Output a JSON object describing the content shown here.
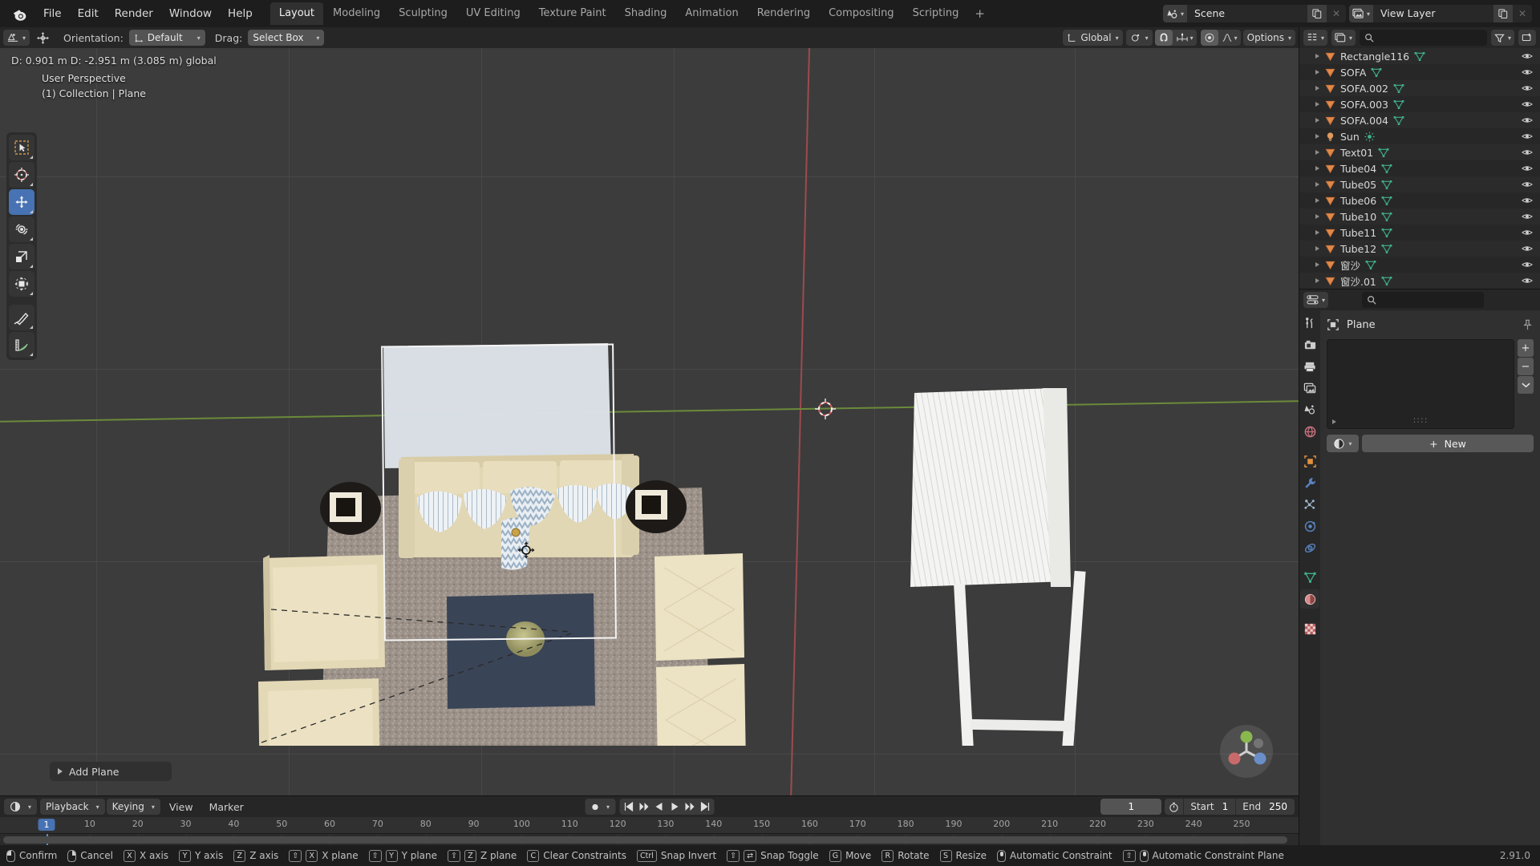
{
  "app": {
    "name": "Blender",
    "version": "2.91.0"
  },
  "topbar": {
    "logo_icon": "blender-logo-icon",
    "menus": [
      "File",
      "Edit",
      "Render",
      "Window",
      "Help"
    ],
    "workspaces": [
      {
        "label": "Layout",
        "active": true
      },
      {
        "label": "Modeling",
        "active": false
      },
      {
        "label": "Sculpting",
        "active": false
      },
      {
        "label": "UV Editing",
        "active": false
      },
      {
        "label": "Texture Paint",
        "active": false
      },
      {
        "label": "Shading",
        "active": false
      },
      {
        "label": "Animation",
        "active": false
      },
      {
        "label": "Rendering",
        "active": false
      },
      {
        "label": "Compositing",
        "active": false
      },
      {
        "label": "Scripting",
        "active": false
      }
    ],
    "add_workspace_label": "+",
    "scene": {
      "icon": "scene-icon",
      "value": "Scene",
      "new_icon": "duplicate-icon",
      "remove_icon": "x-icon"
    },
    "view_layer": {
      "icon": "view-layer-icon",
      "value": "View Layer",
      "new_icon": "duplicate-icon",
      "remove_icon": "x-icon"
    }
  },
  "viewport_header": {
    "editor_type_icon": "editor-type-icon",
    "mode_icon": "object-mode-icon",
    "transform_icon": "transform-gizmo-icon",
    "orientation_label": "Orientation:",
    "orientation_value": "Default",
    "drag_label": "Drag:",
    "drag_value": "Select Box",
    "pivot_icon": "transform-pivot-icon",
    "global_label": "Global",
    "snap_magnet_icon": "snap-magnet-icon",
    "snap_target_icon": "snap-increment-icon",
    "proportional_icon": "proportional-edit-icon",
    "falloff_icon": "falloff-curve-icon",
    "options_label": "Options"
  },
  "viewport": {
    "transform_readout": "D: 0.901 m   D: -2.951 m (3.085 m) global",
    "perspective": "User Perspective",
    "collection_line": "(1) Collection | Plane",
    "operator_panel": "Add Plane",
    "navigation_gizmo_icon": "navigation-gizmo-icon",
    "cursor_3d_icon": "3d-cursor-icon",
    "move_gizmo_icon": "move-gizmo-icon",
    "tools": [
      {
        "name": "tweak-tool",
        "icon": "cursor-arrow-icon",
        "active": false
      },
      {
        "name": "cursor-tool",
        "icon": "3d-cursor-icon",
        "active": false
      },
      {
        "name": "move-tool",
        "icon": "move-arrows-icon",
        "active": true
      },
      {
        "name": "rotate-tool",
        "icon": "rotate-icon",
        "active": false
      },
      {
        "name": "scale-tool",
        "icon": "scale-icon",
        "active": false
      },
      {
        "name": "transform-tool",
        "icon": "transform-icon",
        "active": false
      },
      {
        "name": "annotate-tool",
        "icon": "pencil-icon",
        "active": false
      },
      {
        "name": "measure-tool",
        "icon": "ruler-icon",
        "active": false
      }
    ],
    "scene_objects": {
      "floor_rug_color": "#9b9087",
      "sofa_color": "#e4d9b6",
      "coffee_table_color": "#3a4456",
      "wall_color": "#dde3e8",
      "side_table_color": "#211c19",
      "shelf_color": "#f2f2f0",
      "plant_color": "#a8a271"
    }
  },
  "outliner": {
    "editor_icon": "outliner-icon",
    "display_mode_icon": "view-layer-icon",
    "search_placeholder": "",
    "search_icon": "search-icon",
    "filter_icon": "filter-funnel-icon",
    "new_collection_icon": "new-collection-icon",
    "items": [
      {
        "name": "Rectangle116",
        "type_icon": "mesh-object-icon",
        "data_icon": "mesh-data-icon"
      },
      {
        "name": "SOFA",
        "type_icon": "mesh-object-icon",
        "data_icon": "mesh-data-icon"
      },
      {
        "name": "SOFA.002",
        "type_icon": "mesh-object-icon",
        "data_icon": "mesh-data-icon"
      },
      {
        "name": "SOFA.003",
        "type_icon": "mesh-object-icon",
        "data_icon": "mesh-data-icon"
      },
      {
        "name": "SOFA.004",
        "type_icon": "mesh-object-icon",
        "data_icon": "mesh-data-icon"
      },
      {
        "name": "Sun",
        "type_icon": "light-object-icon",
        "data_icon": "sun-data-icon"
      },
      {
        "name": "Text01",
        "type_icon": "mesh-object-icon",
        "data_icon": "mesh-data-icon"
      },
      {
        "name": "Tube04",
        "type_icon": "mesh-object-icon",
        "data_icon": "mesh-data-icon"
      },
      {
        "name": "Tube05",
        "type_icon": "mesh-object-icon",
        "data_icon": "mesh-data-icon"
      },
      {
        "name": "Tube06",
        "type_icon": "mesh-object-icon",
        "data_icon": "mesh-data-icon"
      },
      {
        "name": "Tube10",
        "type_icon": "mesh-object-icon",
        "data_icon": "mesh-data-icon"
      },
      {
        "name": "Tube11",
        "type_icon": "mesh-object-icon",
        "data_icon": "mesh-data-icon"
      },
      {
        "name": "Tube12",
        "type_icon": "mesh-object-icon",
        "data_icon": "mesh-data-icon"
      },
      {
        "name": "窗沙",
        "type_icon": "mesh-object-icon",
        "data_icon": "mesh-data-icon"
      },
      {
        "name": "窗沙.01",
        "type_icon": "mesh-object-icon",
        "data_icon": "mesh-data-icon"
      }
    ],
    "visibility_icon": "eye-icon"
  },
  "properties": {
    "editor_icon": "properties-icon",
    "search_placeholder": "",
    "search_icon": "search-icon",
    "object_name": "Plane",
    "object_icon": "object-data-icon",
    "pin_icon": "pin-icon",
    "slot_add_label": "+",
    "slot_remove_label": "−",
    "slot_menu_icon": "chevron-down-icon",
    "slot_dots": "::::",
    "browse_material_icon": "material-sphere-icon",
    "new_label": "New",
    "new_plus": "+",
    "tabs": [
      {
        "name": "tool",
        "icon": "tool-wrench-screwdriver-icon",
        "active": false
      },
      {
        "name": "render",
        "icon": "camera-back-icon",
        "active": false
      },
      {
        "name": "output",
        "icon": "printer-icon",
        "active": false
      },
      {
        "name": "view-layer",
        "icon": "images-icon",
        "active": false
      },
      {
        "name": "scene",
        "icon": "scene-cone-icon",
        "active": false
      },
      {
        "name": "world",
        "icon": "world-globe-icon",
        "active": false
      },
      {
        "name": "object",
        "icon": "object-square-icon",
        "active": false
      },
      {
        "name": "modifiers",
        "icon": "wrench-icon",
        "active": false
      },
      {
        "name": "particles",
        "icon": "particles-icon",
        "active": false
      },
      {
        "name": "physics",
        "icon": "physics-orbit-icon",
        "active": false
      },
      {
        "name": "constraints",
        "icon": "constraint-icon",
        "active": false
      },
      {
        "name": "object-data",
        "icon": "mesh-data-icon",
        "active": false
      },
      {
        "name": "material",
        "icon": "material-sphere-icon",
        "active": true
      },
      {
        "name": "texture",
        "icon": "texture-checker-icon",
        "active": false
      }
    ]
  },
  "timeline": {
    "editor_icon": "timeline-icon",
    "menus": [
      {
        "label": "Playback",
        "dropdown": true
      },
      {
        "label": "Keying",
        "dropdown": true
      },
      {
        "label": "View",
        "dropdown": false
      },
      {
        "label": "Marker",
        "dropdown": false
      }
    ],
    "auto_key_icon": "record-dot-icon",
    "transport": [
      {
        "name": "jump-to-start-button",
        "icon": "skip-start-icon"
      },
      {
        "name": "jump-to-prev-keyframe-button",
        "icon": "prev-keyframe-icon"
      },
      {
        "name": "play-reverse-button",
        "icon": "play-reverse-icon"
      },
      {
        "name": "play-button",
        "icon": "play-icon"
      },
      {
        "name": "jump-to-next-keyframe-button",
        "icon": "next-keyframe-icon"
      },
      {
        "name": "jump-to-end-button",
        "icon": "skip-end-icon"
      }
    ],
    "current_frame": "1",
    "use_preview_range_icon": "stopwatch-icon",
    "start_label": "Start",
    "start_value": "1",
    "end_label": "End",
    "end_value": "250",
    "playhead_frame": 1,
    "ticks": [
      10,
      20,
      30,
      40,
      50,
      60,
      70,
      80,
      90,
      100,
      110,
      120,
      130,
      140,
      150,
      160,
      170,
      180,
      190,
      200,
      210,
      220,
      230,
      240,
      250
    ]
  },
  "statusbar": {
    "items": [
      {
        "keys": [
          {
            "type": "mouse",
            "variant": "left"
          }
        ],
        "label": "Confirm"
      },
      {
        "keys": [
          {
            "type": "mouse",
            "variant": "right"
          }
        ],
        "label": "Cancel"
      },
      {
        "keys": [
          {
            "type": "key",
            "label": "X"
          }
        ],
        "label": "X axis"
      },
      {
        "keys": [
          {
            "type": "key",
            "label": "Y"
          }
        ],
        "label": "Y axis"
      },
      {
        "keys": [
          {
            "type": "key",
            "label": "Z"
          }
        ],
        "label": "Z axis"
      },
      {
        "keys": [
          {
            "type": "key",
            "label": "⇧"
          },
          {
            "type": "key",
            "label": "X"
          }
        ],
        "label": "X plane"
      },
      {
        "keys": [
          {
            "type": "key",
            "label": "⇧"
          },
          {
            "type": "key",
            "label": "Y"
          }
        ],
        "label": "Y plane"
      },
      {
        "keys": [
          {
            "type": "key",
            "label": "⇧"
          },
          {
            "type": "key",
            "label": "Z"
          }
        ],
        "label": "Z plane"
      },
      {
        "keys": [
          {
            "type": "key",
            "label": "C"
          }
        ],
        "label": "Clear Constraints"
      },
      {
        "keys": [
          {
            "type": "key",
            "label": "Ctrl"
          }
        ],
        "label": "Snap Invert"
      },
      {
        "keys": [
          {
            "type": "key",
            "label": "⇧"
          },
          {
            "type": "key",
            "label": "⇄"
          }
        ],
        "label": "Snap Toggle"
      },
      {
        "keys": [
          {
            "type": "key",
            "label": "G"
          }
        ],
        "label": "Move"
      },
      {
        "keys": [
          {
            "type": "key",
            "label": "R"
          }
        ],
        "label": "Rotate"
      },
      {
        "keys": [
          {
            "type": "key",
            "label": "S"
          }
        ],
        "label": "Resize"
      },
      {
        "keys": [
          {
            "type": "mouse",
            "variant": "middle"
          }
        ],
        "label": "Automatic Constraint"
      },
      {
        "keys": [
          {
            "type": "key",
            "label": "⇧"
          },
          {
            "type": "mouse",
            "variant": "middle"
          }
        ],
        "label": "Automatic Constraint Plane"
      }
    ],
    "version": "2.91.0"
  }
}
